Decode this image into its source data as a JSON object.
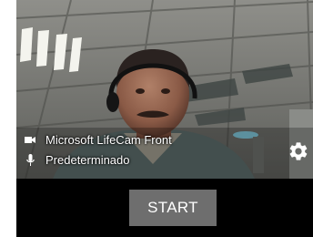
{
  "devices": {
    "camera": {
      "icon": "videocam-icon",
      "label": "Microsoft LifeCam Front"
    },
    "microphone": {
      "icon": "microphone-icon",
      "label": "Predeterminado"
    }
  },
  "settings": {
    "icon": "gear-icon"
  },
  "actions": {
    "start_label": "START"
  },
  "colors": {
    "background": "#000000",
    "button": "#6e6e6e",
    "text": "#ffffff"
  }
}
